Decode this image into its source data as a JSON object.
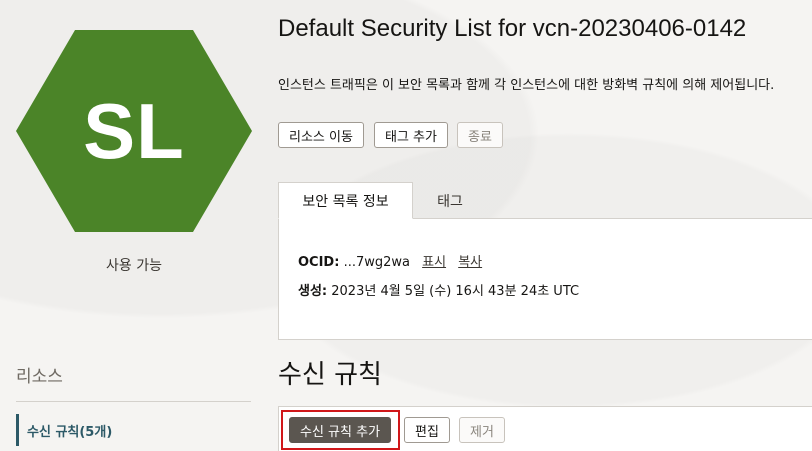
{
  "badge": {
    "initials": "SL",
    "color": "#4b8428"
  },
  "status": "사용 가능",
  "resources": {
    "title": "리소스",
    "items": [
      {
        "label": "수신 규칙(5개)"
      }
    ]
  },
  "page_title": "Default Security List for vcn-20230406-0142",
  "description": "인스턴스 트래픽은 이 보안 목록과 함께 각 인스턴스에 대한 방화벽 규칙에 의해 제어됩니다.",
  "actions": {
    "move": "리소스 이동",
    "add_tag": "태그 추가",
    "terminate": "종료"
  },
  "tabs": [
    {
      "label": "보안 목록 정보",
      "active": true
    },
    {
      "label": "태그",
      "active": false
    }
  ],
  "info": {
    "ocid_label": "OCID:",
    "ocid_value": "...7wg2wa",
    "show_link": "표시",
    "copy_link": "복사",
    "created_label": "생성:",
    "created_value": "2023년 4월 5일 (수) 16시 43분 24초 UTC"
  },
  "section_title": "수신 규칙",
  "rule_actions": {
    "add": "수신 규칙 추가",
    "edit": "편집",
    "remove": "제거"
  },
  "colors": {
    "accent": "#2c5967",
    "primary_button": "#5b5650",
    "highlight": "#d0171a"
  }
}
